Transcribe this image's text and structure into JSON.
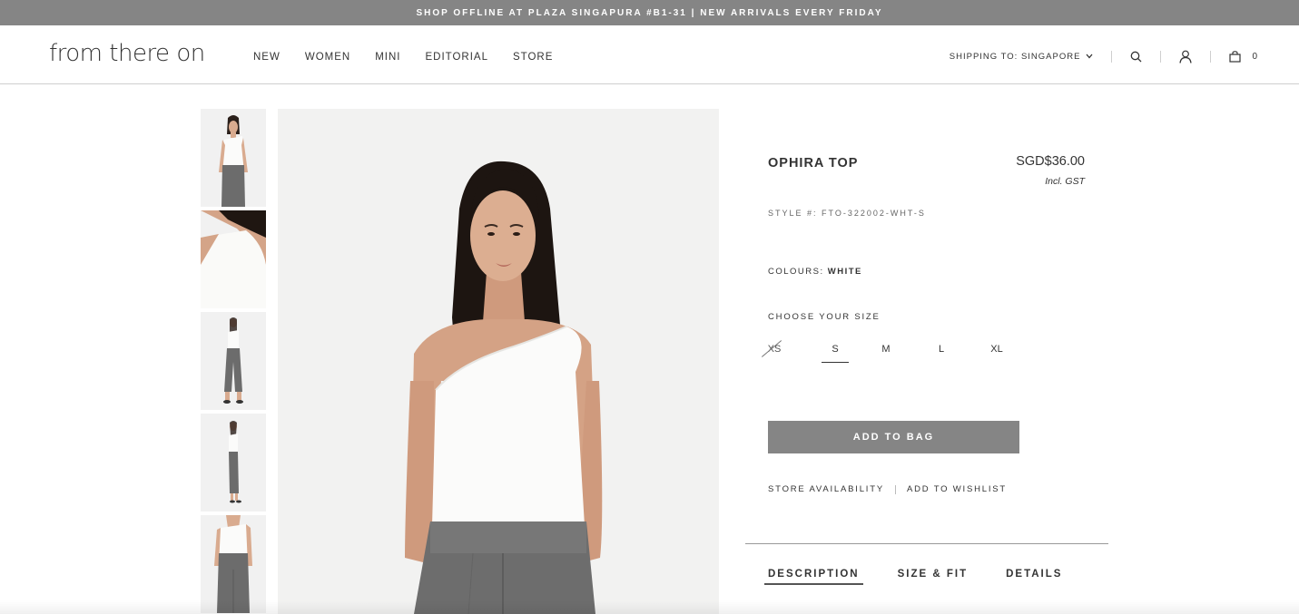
{
  "announcement": "SHOP OFFLINE AT PLAZA SINGAPURA #B1-31 | NEW ARRIVALS EVERY FRIDAY",
  "header": {
    "logo": "from there on",
    "nav": [
      "NEW",
      "WOMEN",
      "MINI",
      "EDITORIAL",
      "STORE"
    ],
    "shipping": "SHIPPING TO: SINGAPORE",
    "bag_count": "0"
  },
  "gallery": {
    "thumbnails": [
      "thumb-front",
      "thumb-detail",
      "thumb-full-front",
      "thumb-full-side",
      "thumb-back"
    ]
  },
  "product": {
    "name": "OPHIRA TOP",
    "price": "SGD$36.00",
    "tax_note": "Incl. GST",
    "style_label": "STYLE #: FTO-322002-WHT-S",
    "colours_label": "COLOURS:",
    "colour": "WHITE",
    "choose_size_label": "CHOOSE YOUR SIZE",
    "sizes": [
      "XS",
      "S",
      "M",
      "L",
      "XL"
    ],
    "selected_size": "S",
    "unavailable_sizes": [
      "XS"
    ],
    "add_to_bag": "ADD TO BAG",
    "store_availability": "STORE AVAILABILITY",
    "add_to_wishlist": "ADD TO WISHLIST"
  },
  "tabs": [
    "DESCRIPTION",
    "SIZE & FIT",
    "DETAILS"
  ],
  "colors": {
    "announcement_bg": "#858585",
    "button_bg": "#858585",
    "text": "#333333"
  }
}
